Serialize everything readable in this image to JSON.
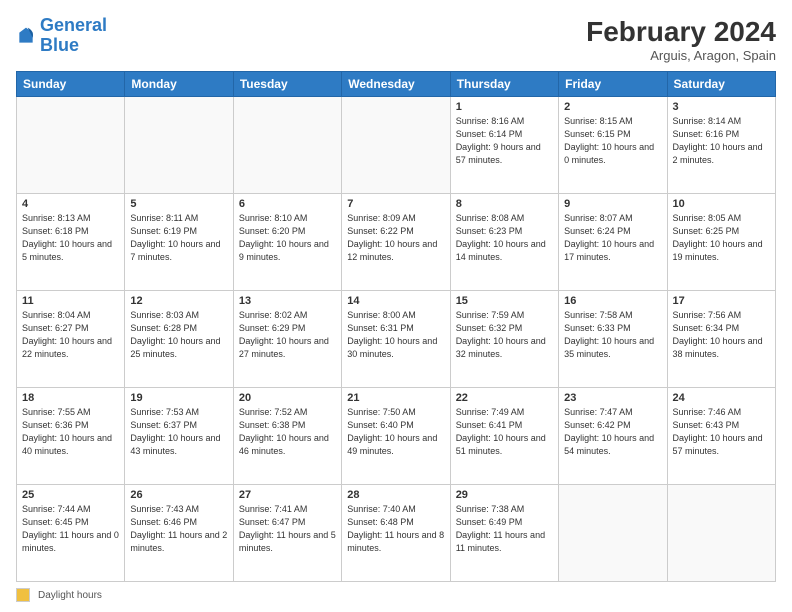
{
  "logo": {
    "text1": "General",
    "text2": "Blue"
  },
  "header": {
    "month_year": "February 2024",
    "location": "Arguis, Aragon, Spain"
  },
  "days_of_week": [
    "Sunday",
    "Monday",
    "Tuesday",
    "Wednesday",
    "Thursday",
    "Friday",
    "Saturday"
  ],
  "footer": {
    "legend_label": "Daylight hours"
  },
  "weeks": [
    [
      {
        "day": "",
        "info": ""
      },
      {
        "day": "",
        "info": ""
      },
      {
        "day": "",
        "info": ""
      },
      {
        "day": "",
        "info": ""
      },
      {
        "day": "1",
        "info": "Sunrise: 8:16 AM\nSunset: 6:14 PM\nDaylight: 9 hours and 57 minutes."
      },
      {
        "day": "2",
        "info": "Sunrise: 8:15 AM\nSunset: 6:15 PM\nDaylight: 10 hours and 0 minutes."
      },
      {
        "day": "3",
        "info": "Sunrise: 8:14 AM\nSunset: 6:16 PM\nDaylight: 10 hours and 2 minutes."
      }
    ],
    [
      {
        "day": "4",
        "info": "Sunrise: 8:13 AM\nSunset: 6:18 PM\nDaylight: 10 hours and 5 minutes."
      },
      {
        "day": "5",
        "info": "Sunrise: 8:11 AM\nSunset: 6:19 PM\nDaylight: 10 hours and 7 minutes."
      },
      {
        "day": "6",
        "info": "Sunrise: 8:10 AM\nSunset: 6:20 PM\nDaylight: 10 hours and 9 minutes."
      },
      {
        "day": "7",
        "info": "Sunrise: 8:09 AM\nSunset: 6:22 PM\nDaylight: 10 hours and 12 minutes."
      },
      {
        "day": "8",
        "info": "Sunrise: 8:08 AM\nSunset: 6:23 PM\nDaylight: 10 hours and 14 minutes."
      },
      {
        "day": "9",
        "info": "Sunrise: 8:07 AM\nSunset: 6:24 PM\nDaylight: 10 hours and 17 minutes."
      },
      {
        "day": "10",
        "info": "Sunrise: 8:05 AM\nSunset: 6:25 PM\nDaylight: 10 hours and 19 minutes."
      }
    ],
    [
      {
        "day": "11",
        "info": "Sunrise: 8:04 AM\nSunset: 6:27 PM\nDaylight: 10 hours and 22 minutes."
      },
      {
        "day": "12",
        "info": "Sunrise: 8:03 AM\nSunset: 6:28 PM\nDaylight: 10 hours and 25 minutes."
      },
      {
        "day": "13",
        "info": "Sunrise: 8:02 AM\nSunset: 6:29 PM\nDaylight: 10 hours and 27 minutes."
      },
      {
        "day": "14",
        "info": "Sunrise: 8:00 AM\nSunset: 6:31 PM\nDaylight: 10 hours and 30 minutes."
      },
      {
        "day": "15",
        "info": "Sunrise: 7:59 AM\nSunset: 6:32 PM\nDaylight: 10 hours and 32 minutes."
      },
      {
        "day": "16",
        "info": "Sunrise: 7:58 AM\nSunset: 6:33 PM\nDaylight: 10 hours and 35 minutes."
      },
      {
        "day": "17",
        "info": "Sunrise: 7:56 AM\nSunset: 6:34 PM\nDaylight: 10 hours and 38 minutes."
      }
    ],
    [
      {
        "day": "18",
        "info": "Sunrise: 7:55 AM\nSunset: 6:36 PM\nDaylight: 10 hours and 40 minutes."
      },
      {
        "day": "19",
        "info": "Sunrise: 7:53 AM\nSunset: 6:37 PM\nDaylight: 10 hours and 43 minutes."
      },
      {
        "day": "20",
        "info": "Sunrise: 7:52 AM\nSunset: 6:38 PM\nDaylight: 10 hours and 46 minutes."
      },
      {
        "day": "21",
        "info": "Sunrise: 7:50 AM\nSunset: 6:40 PM\nDaylight: 10 hours and 49 minutes."
      },
      {
        "day": "22",
        "info": "Sunrise: 7:49 AM\nSunset: 6:41 PM\nDaylight: 10 hours and 51 minutes."
      },
      {
        "day": "23",
        "info": "Sunrise: 7:47 AM\nSunset: 6:42 PM\nDaylight: 10 hours and 54 minutes."
      },
      {
        "day": "24",
        "info": "Sunrise: 7:46 AM\nSunset: 6:43 PM\nDaylight: 10 hours and 57 minutes."
      }
    ],
    [
      {
        "day": "25",
        "info": "Sunrise: 7:44 AM\nSunset: 6:45 PM\nDaylight: 11 hours and 0 minutes."
      },
      {
        "day": "26",
        "info": "Sunrise: 7:43 AM\nSunset: 6:46 PM\nDaylight: 11 hours and 2 minutes."
      },
      {
        "day": "27",
        "info": "Sunrise: 7:41 AM\nSunset: 6:47 PM\nDaylight: 11 hours and 5 minutes."
      },
      {
        "day": "28",
        "info": "Sunrise: 7:40 AM\nSunset: 6:48 PM\nDaylight: 11 hours and 8 minutes."
      },
      {
        "day": "29",
        "info": "Sunrise: 7:38 AM\nSunset: 6:49 PM\nDaylight: 11 hours and 11 minutes."
      },
      {
        "day": "",
        "info": ""
      },
      {
        "day": "",
        "info": ""
      }
    ]
  ]
}
